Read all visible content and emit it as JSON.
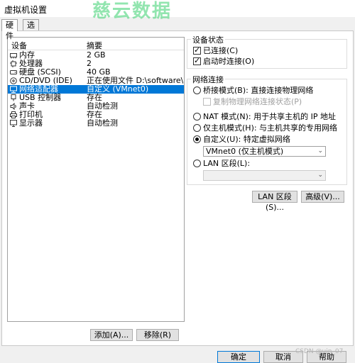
{
  "window": {
    "title": "虚拟机设置",
    "watermark": "慈云数据"
  },
  "tabs": [
    {
      "label": "硬件"
    },
    {
      "label": "选项"
    }
  ],
  "device_list": {
    "col_device": "设备",
    "col_summary": "摘要",
    "rows": [
      {
        "name": "内存",
        "summary": "2 GB",
        "icon": "memory-icon"
      },
      {
        "name": "处理器",
        "summary": "2",
        "icon": "processor-icon"
      },
      {
        "name": "硬盘 (SCSI)",
        "summary": "40 GB",
        "icon": "harddisk-icon"
      },
      {
        "name": "CD/DVD (IDE)",
        "summary": "正在使用文件 D:\\software\\Cen...",
        "icon": "cd-icon"
      },
      {
        "name": "网络适配器",
        "summary": "自定义 (VMnet0)",
        "icon": "network-adapter-icon"
      },
      {
        "name": "USB 控制器",
        "summary": "存在",
        "icon": "usb-icon"
      },
      {
        "name": "声卡",
        "summary": "自动检测",
        "icon": "sound-icon"
      },
      {
        "name": "打印机",
        "summary": "存在",
        "icon": "printer-icon"
      },
      {
        "name": "显示器",
        "summary": "自动检测",
        "icon": "display-icon"
      }
    ],
    "selected_index": 4
  },
  "buttons": {
    "add": "添加(A)...",
    "remove": "移除(R)",
    "ok": "确定",
    "cancel": "取消",
    "help": "帮助",
    "lan_segments": "LAN 区段(S)...",
    "advanced": "高级(V)..."
  },
  "device_status": {
    "legend": "设备状态",
    "connected": "已连接(C)",
    "connect_on_power": "启动时连接(O)"
  },
  "network": {
    "legend": "网络连接",
    "bridged": "桥接模式(B): 直接连接物理网络",
    "replicate": "复制物理网络连接状态(P)",
    "nat": "NAT 模式(N): 用于共享主机的 IP 地址",
    "hostonly": "仅主机模式(H): 与主机共享的专用网络",
    "custom": "自定义(U): 特定虚拟网络",
    "custom_value": "VMnet0 (仅主机模式)",
    "lan": "LAN 区段(L):"
  },
  "footer": {
    "credit": "CSDN @ujn_07"
  }
}
